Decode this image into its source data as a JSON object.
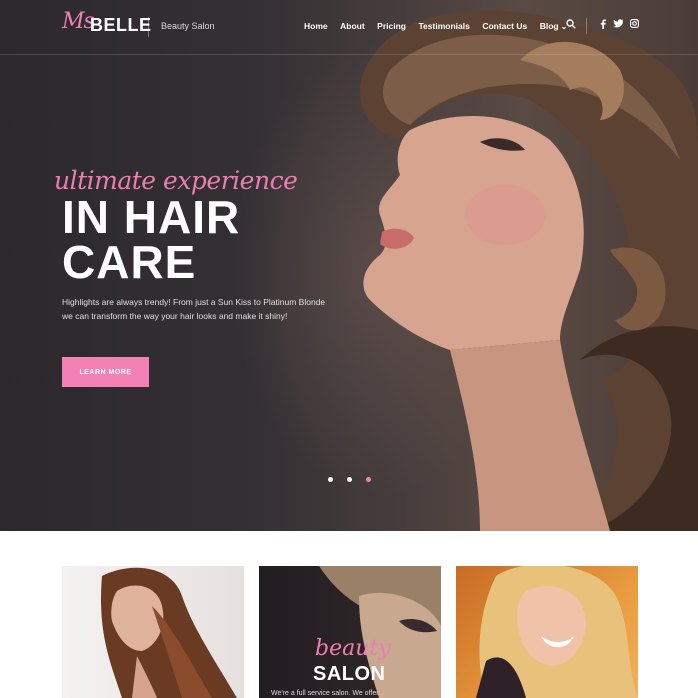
{
  "header": {
    "logo_script": "Ms",
    "logo_main": "BELLE",
    "tagline": "Beauty Salon",
    "nav": [
      {
        "label": "Home"
      },
      {
        "label": "About"
      },
      {
        "label": "Pricing"
      },
      {
        "label": "Testimonials"
      },
      {
        "label": "Contact Us"
      },
      {
        "label": "Blog"
      }
    ],
    "icons": {
      "search": "search-icon",
      "facebook": "f",
      "twitter": "twitter-icon",
      "instagram": "instagram-icon"
    }
  },
  "hero": {
    "script": "ultimate experience",
    "title_line1": "IN HAIR",
    "title_line2": "CARE",
    "description": "Highlights are always trendy! From just a Sun Kiss to Platinum Blonde we can transform the way your hair looks and make it shiny!",
    "cta_label": "LEARN MORE",
    "slides": 3,
    "active_slide": 3
  },
  "cards": [
    {
      "name": "long-hair-card"
    },
    {
      "script": "beauty",
      "title": "SALON",
      "description": "We're a full service salon. We offer..."
    },
    {
      "name": "blonde-smile-card"
    }
  ],
  "colors": {
    "accent": "#f381b5",
    "hero_bg": "#2f2b2e",
    "text_light": "#ffffff"
  }
}
